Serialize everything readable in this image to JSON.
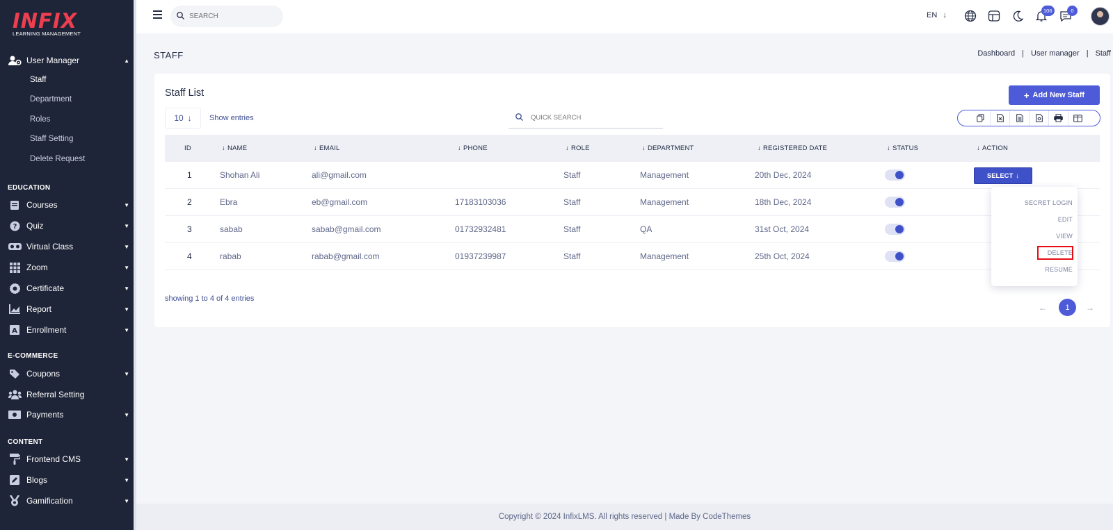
{
  "brand": {
    "logo_word": "INFIX",
    "logo_sub": "LEARNING MANAGEMENT"
  },
  "sidebar": {
    "user_manager": {
      "label": "User Manager",
      "icon": "users-gear-icon",
      "sub": [
        "Staff",
        "Department",
        "Roles",
        "Staff Setting",
        "Delete Request"
      ]
    },
    "education": {
      "title": "EDUCATION",
      "items": [
        {
          "label": "Courses",
          "icon": "book-icon"
        },
        {
          "label": "Quiz",
          "icon": "question-icon"
        },
        {
          "label": "Virtual Class",
          "icon": "vr-icon"
        },
        {
          "label": "Zoom",
          "icon": "grid-icon"
        },
        {
          "label": "Certificate",
          "icon": "certificate-icon"
        },
        {
          "label": "Report",
          "icon": "chart-icon"
        },
        {
          "label": "Enrollment",
          "icon": "enrollment-icon"
        }
      ]
    },
    "ecommerce": {
      "title": "E-COMMERCE",
      "items": [
        {
          "label": "Coupons",
          "icon": "coupon-icon"
        },
        {
          "label": "Referral Setting",
          "icon": "referral-icon"
        },
        {
          "label": "Payments",
          "icon": "money-icon"
        }
      ]
    },
    "content": {
      "title": "CONTENT",
      "items": [
        {
          "label": "Frontend CMS",
          "icon": "paint-roller-icon"
        },
        {
          "label": "Blogs",
          "icon": "edit-icon"
        },
        {
          "label": "Gamification",
          "icon": "medal-icon"
        }
      ]
    }
  },
  "topbar": {
    "search_placeholder": "SEARCH",
    "language": "EN",
    "notifications_count": "106",
    "messages_count": "0"
  },
  "page": {
    "title": "STAFF",
    "breadcrumb": [
      "Dashboard",
      "User manager",
      "Staff"
    ]
  },
  "card": {
    "title": "Staff List",
    "add_button": "Add New Staff",
    "entries_value": "10",
    "entries_label": "Show entries",
    "quick_search_placeholder": "QUICK SEARCH"
  },
  "table": {
    "headers": [
      "ID",
      "NAME",
      "EMAIL",
      "PHONE",
      "ROLE",
      "DEPARTMENT",
      "REGISTERED DATE",
      "STATUS",
      "ACTION"
    ],
    "rows": [
      {
        "id": "1",
        "name": "Shohan Ali",
        "email": "ali@gmail.com",
        "phone": "",
        "role": "Staff",
        "department": "Management",
        "date": "20th Dec, 2024",
        "status": true
      },
      {
        "id": "2",
        "name": "Ebra",
        "email": "eb@gmail.com",
        "phone": "17183103036",
        "role": "Staff",
        "department": "Management",
        "date": "18th Dec, 2024",
        "status": true
      },
      {
        "id": "3",
        "name": "sabab",
        "email": "sabab@gmail.com",
        "phone": "01732932481",
        "role": "Staff",
        "department": "QA",
        "date": "31st Oct, 2024",
        "status": true
      },
      {
        "id": "4",
        "name": "rabab",
        "email": "rabab@gmail.com",
        "phone": "01937239987",
        "role": "Staff",
        "department": "Management",
        "date": "25th Oct, 2024",
        "status": true
      }
    ],
    "select_label": "SELECT"
  },
  "dropdown": {
    "items": [
      "SECRET LOGIN",
      "EDIT",
      "VIEW",
      "DELETE",
      "RESUME"
    ]
  },
  "pagination": {
    "showing": "showing 1 to 4 of 4 entries",
    "current": "1"
  },
  "footer": {
    "text": "Copyright © 2024 InfixLMS. All rights reserved | Made By CodeThemes"
  },
  "colors": {
    "sidebar_bg": "#1f2538",
    "accent": "#4d5bd9",
    "highlight": "#e60d12"
  }
}
